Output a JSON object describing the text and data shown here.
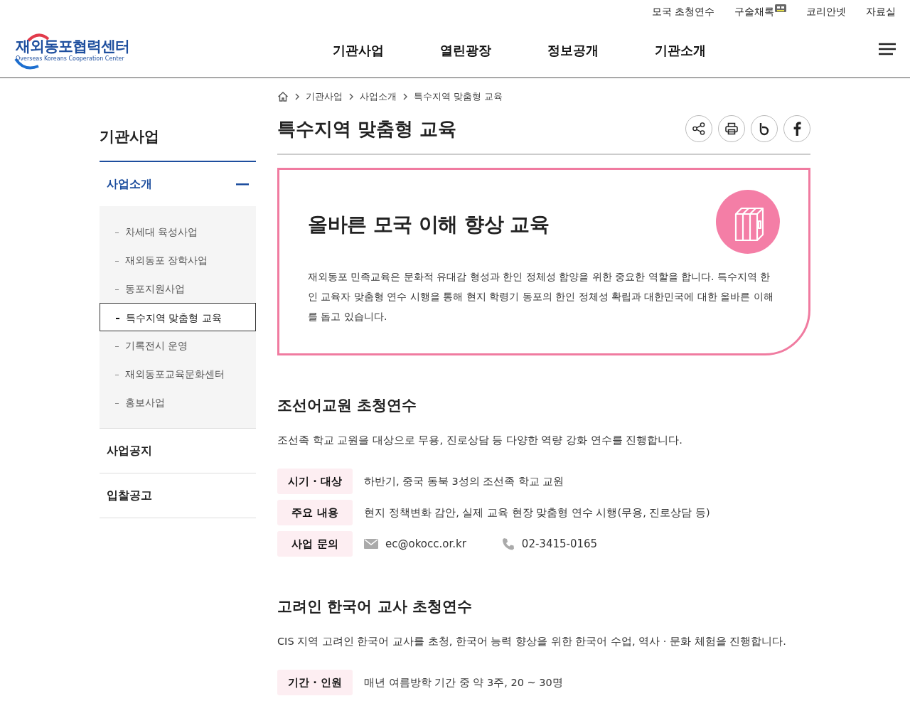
{
  "utility_links": [
    {
      "label": "모국 초청연수",
      "kind": "plain"
    },
    {
      "label": "구술채록",
      "kind": "badge"
    },
    {
      "label": "코리안넷",
      "kind": "plain"
    },
    {
      "label": "자료실",
      "kind": "plain"
    }
  ],
  "logo": {
    "name": "재외동포협력센터",
    "subtitle": "Overseas Koreans Cooperation Center"
  },
  "main_nav": [
    "기관사업",
    "열린광장",
    "정보공개",
    "기관소개"
  ],
  "sidebar": {
    "title": "기관사업",
    "groups": [
      {
        "label": "사업소개",
        "expanded": true,
        "children": [
          {
            "label": "차세대 육성사업",
            "selected": false
          },
          {
            "label": "재외동포 장학사업",
            "selected": false
          },
          {
            "label": "동포지원사업",
            "selected": false
          },
          {
            "label": "특수지역 맞춤형 교육",
            "selected": true
          },
          {
            "label": "기록전시 운영",
            "selected": false
          },
          {
            "label": "재외동포교육문화센터",
            "selected": false
          },
          {
            "label": "홍보사업",
            "selected": false
          }
        ]
      },
      {
        "label": "사업공지",
        "expanded": false
      },
      {
        "label": "입찰공고",
        "expanded": false
      }
    ]
  },
  "breadcrumb": [
    "기관사업",
    "사업소개",
    "특수지역 맞춤형 교육"
  ],
  "page_title": "특수지역 맞춤형 교육",
  "intro_card": {
    "heading": "올바른 모국 이해 향상 교육",
    "body": "재외동포 민족교육은 문화적 유대감 형성과 한인 정체성 함양을 위한 중요한 역할을 합니다. 특수지역 한인 교육자 맞춤형 연수 시행을 통해 현지 학령기 동포의 한인 정체성 확립과 대한민국에 대한 올바른 이해를 돕고 있습니다."
  },
  "sections": [
    {
      "title": "조선어교원 초청연수",
      "description": "조선족 학교 교원을 대상으로 무용, 진로상담 등 다양한 역량 강화 연수를 진행합니다.",
      "rows": [
        {
          "kind": "text",
          "label": "시기 · 대상",
          "value": "하반기, 중국 동북 3성의 조선족 학교 교원"
        },
        {
          "kind": "text",
          "label": "주요 내용",
          "value": "현지 정책변화 감안, 실제 교육 현장 맞춤형 연수 시행(무용, 진로상담 등)"
        },
        {
          "kind": "contact",
          "label": "사업 문의",
          "email": "ec@okocc.or.kr",
          "phone": "02-3415-0165"
        }
      ]
    },
    {
      "title": "고려인 한국어 교사 초청연수",
      "description": "CIS 지역 고려인 한국어 교사를 초청, 한국어 능력 향상을 위한 한국어 수업, 역사 · 문화 체험을 진행합니다.",
      "rows": [
        {
          "kind": "text",
          "label": "기간 · 인원",
          "value": "매년 여름방학 기간 중 약 3주, 20 ~ 30명"
        }
      ]
    }
  ]
}
